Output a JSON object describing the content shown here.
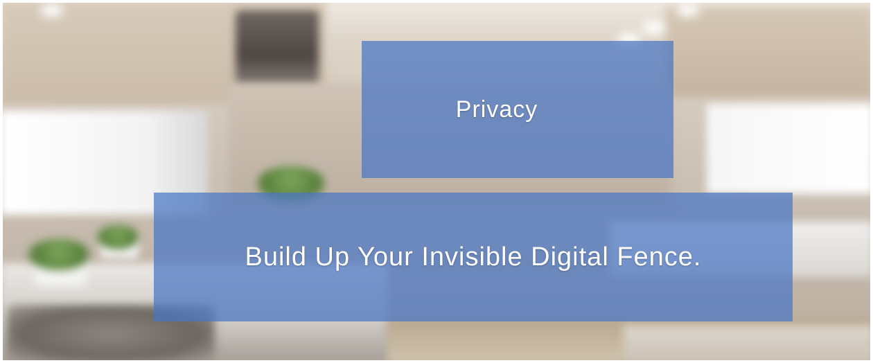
{
  "banner": {
    "tag": "Privacy",
    "headline": "Build Up Your Invisible Digital Fence."
  },
  "colors": {
    "overlay": "#4a76c4",
    "text": "#ffffff"
  }
}
